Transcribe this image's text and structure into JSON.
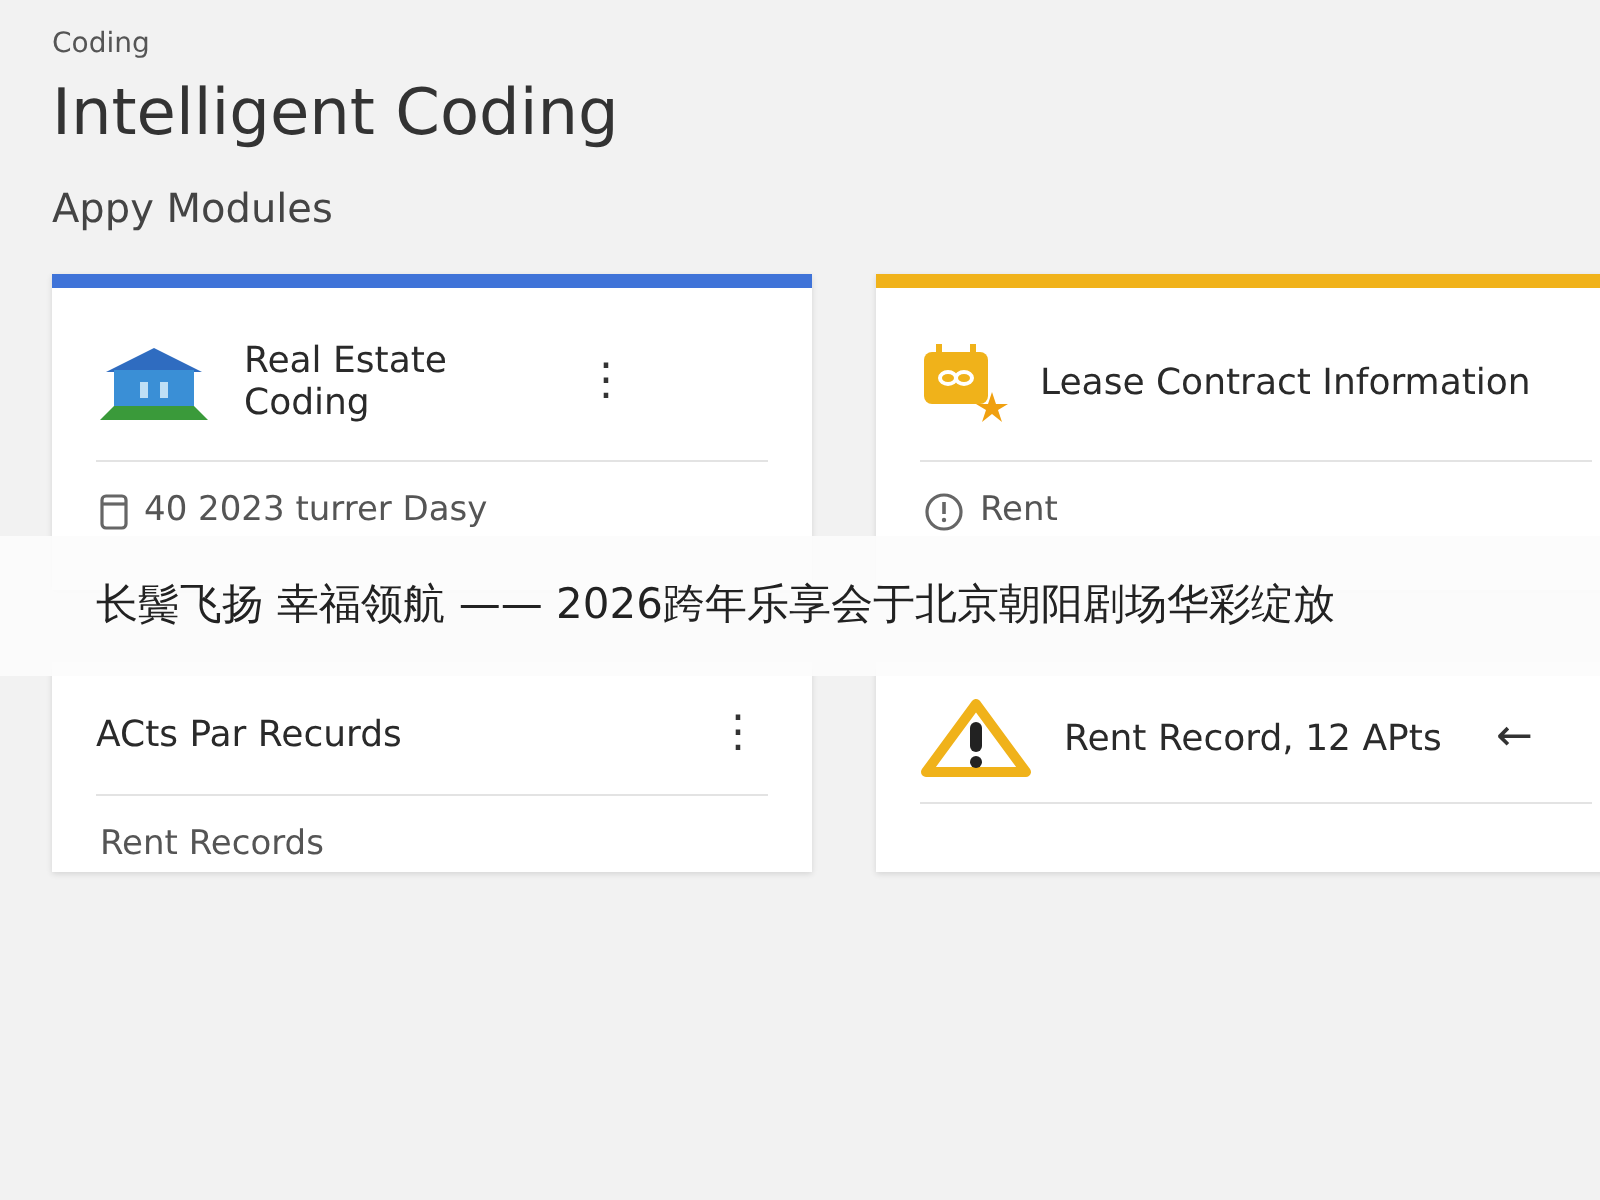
{
  "breadcrumb": "Coding",
  "title": "Intelligent Coding",
  "section": "Appy Modules",
  "cards": [
    {
      "title": "Real Estate Coding",
      "color": "#3f73d8",
      "menu": "⋮",
      "detail": "40 2023 turrer Dasy"
    },
    {
      "title": "Lease Contract Information",
      "color": "#f0b21a",
      "detail": "Rent"
    },
    {
      "title": "ACts Par Recurds",
      "menu": "⋮",
      "detail": "Rent Records"
    },
    {
      "title": "Rent Record, 12 APts",
      "action": "←"
    }
  ],
  "banner": "长鬓飞扬 幸福领航 —— 2026跨年乐享会于北京朝阳剧场华彩绽放"
}
